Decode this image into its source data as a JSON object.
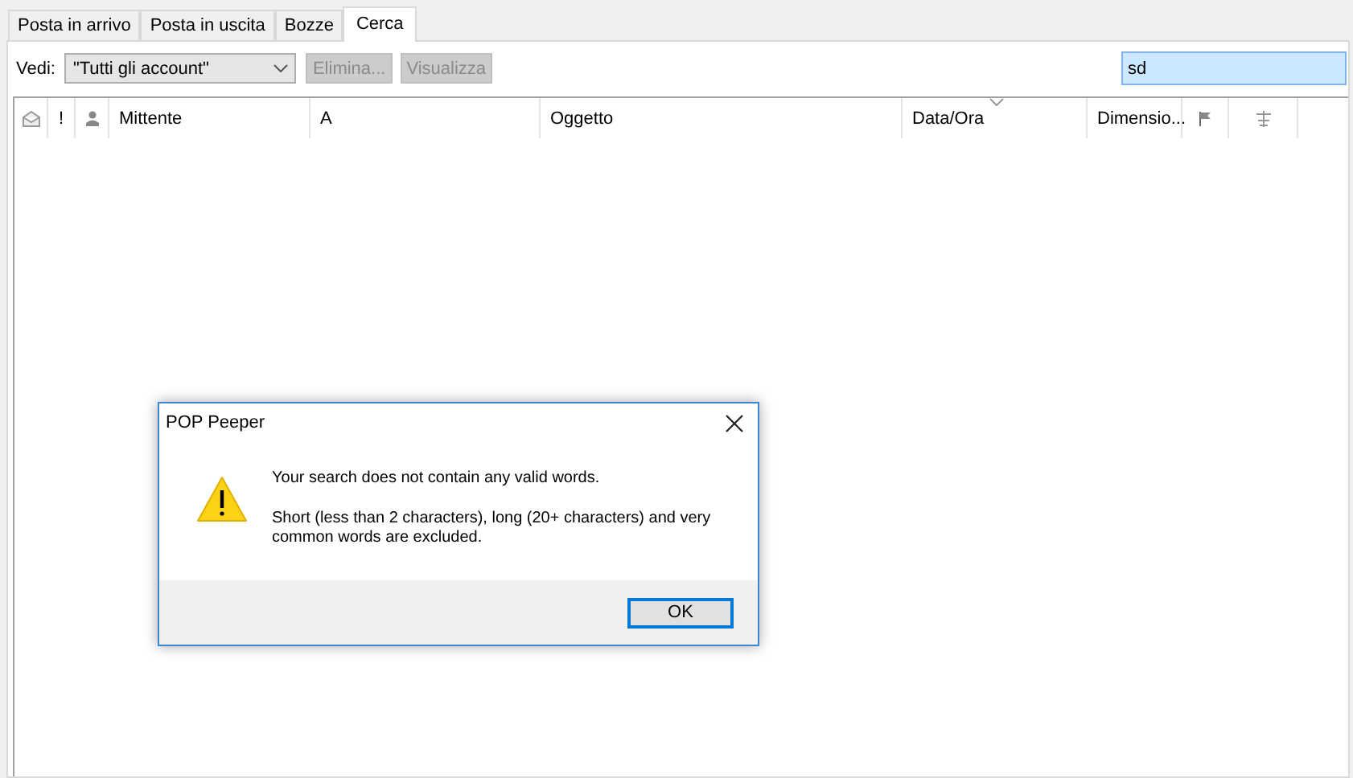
{
  "tabs": [
    {
      "label": "Posta in arrivo",
      "selected": false
    },
    {
      "label": "Posta in uscita",
      "selected": false
    },
    {
      "label": "Bozze",
      "selected": false
    },
    {
      "label": "Cerca",
      "selected": true
    }
  ],
  "toolbar": {
    "view_label": "Vedi:",
    "view_value": "\"Tutti gli account\"",
    "buttons": [
      {
        "label": "Elimina...",
        "disabled": true
      },
      {
        "label": "Visualizza",
        "disabled": true
      }
    ],
    "search": {
      "value": "sd"
    }
  },
  "table": {
    "columns": [
      {
        "kind": "read-icon"
      },
      {
        "kind": "priority",
        "label": "!"
      },
      {
        "kind": "person-icon"
      },
      {
        "kind": "text",
        "label": "Mittente",
        "sorted": false
      },
      {
        "kind": "text",
        "label": "A",
        "sorted": false
      },
      {
        "kind": "text",
        "label": "Oggetto",
        "sorted": false
      },
      {
        "kind": "text",
        "label": "Data/Ora",
        "sorted": true
      },
      {
        "kind": "text",
        "label": "Dimensio...",
        "sorted": false
      },
      {
        "kind": "flag-icon"
      },
      {
        "kind": "attach-icon"
      }
    ]
  },
  "dialog": {
    "title": "POP Peeper",
    "message": "Your search does not contain any valid words.",
    "detail": "Short (less than 2 characters), long (20+ characters) and very common words are excluded.",
    "button": "OK"
  }
}
